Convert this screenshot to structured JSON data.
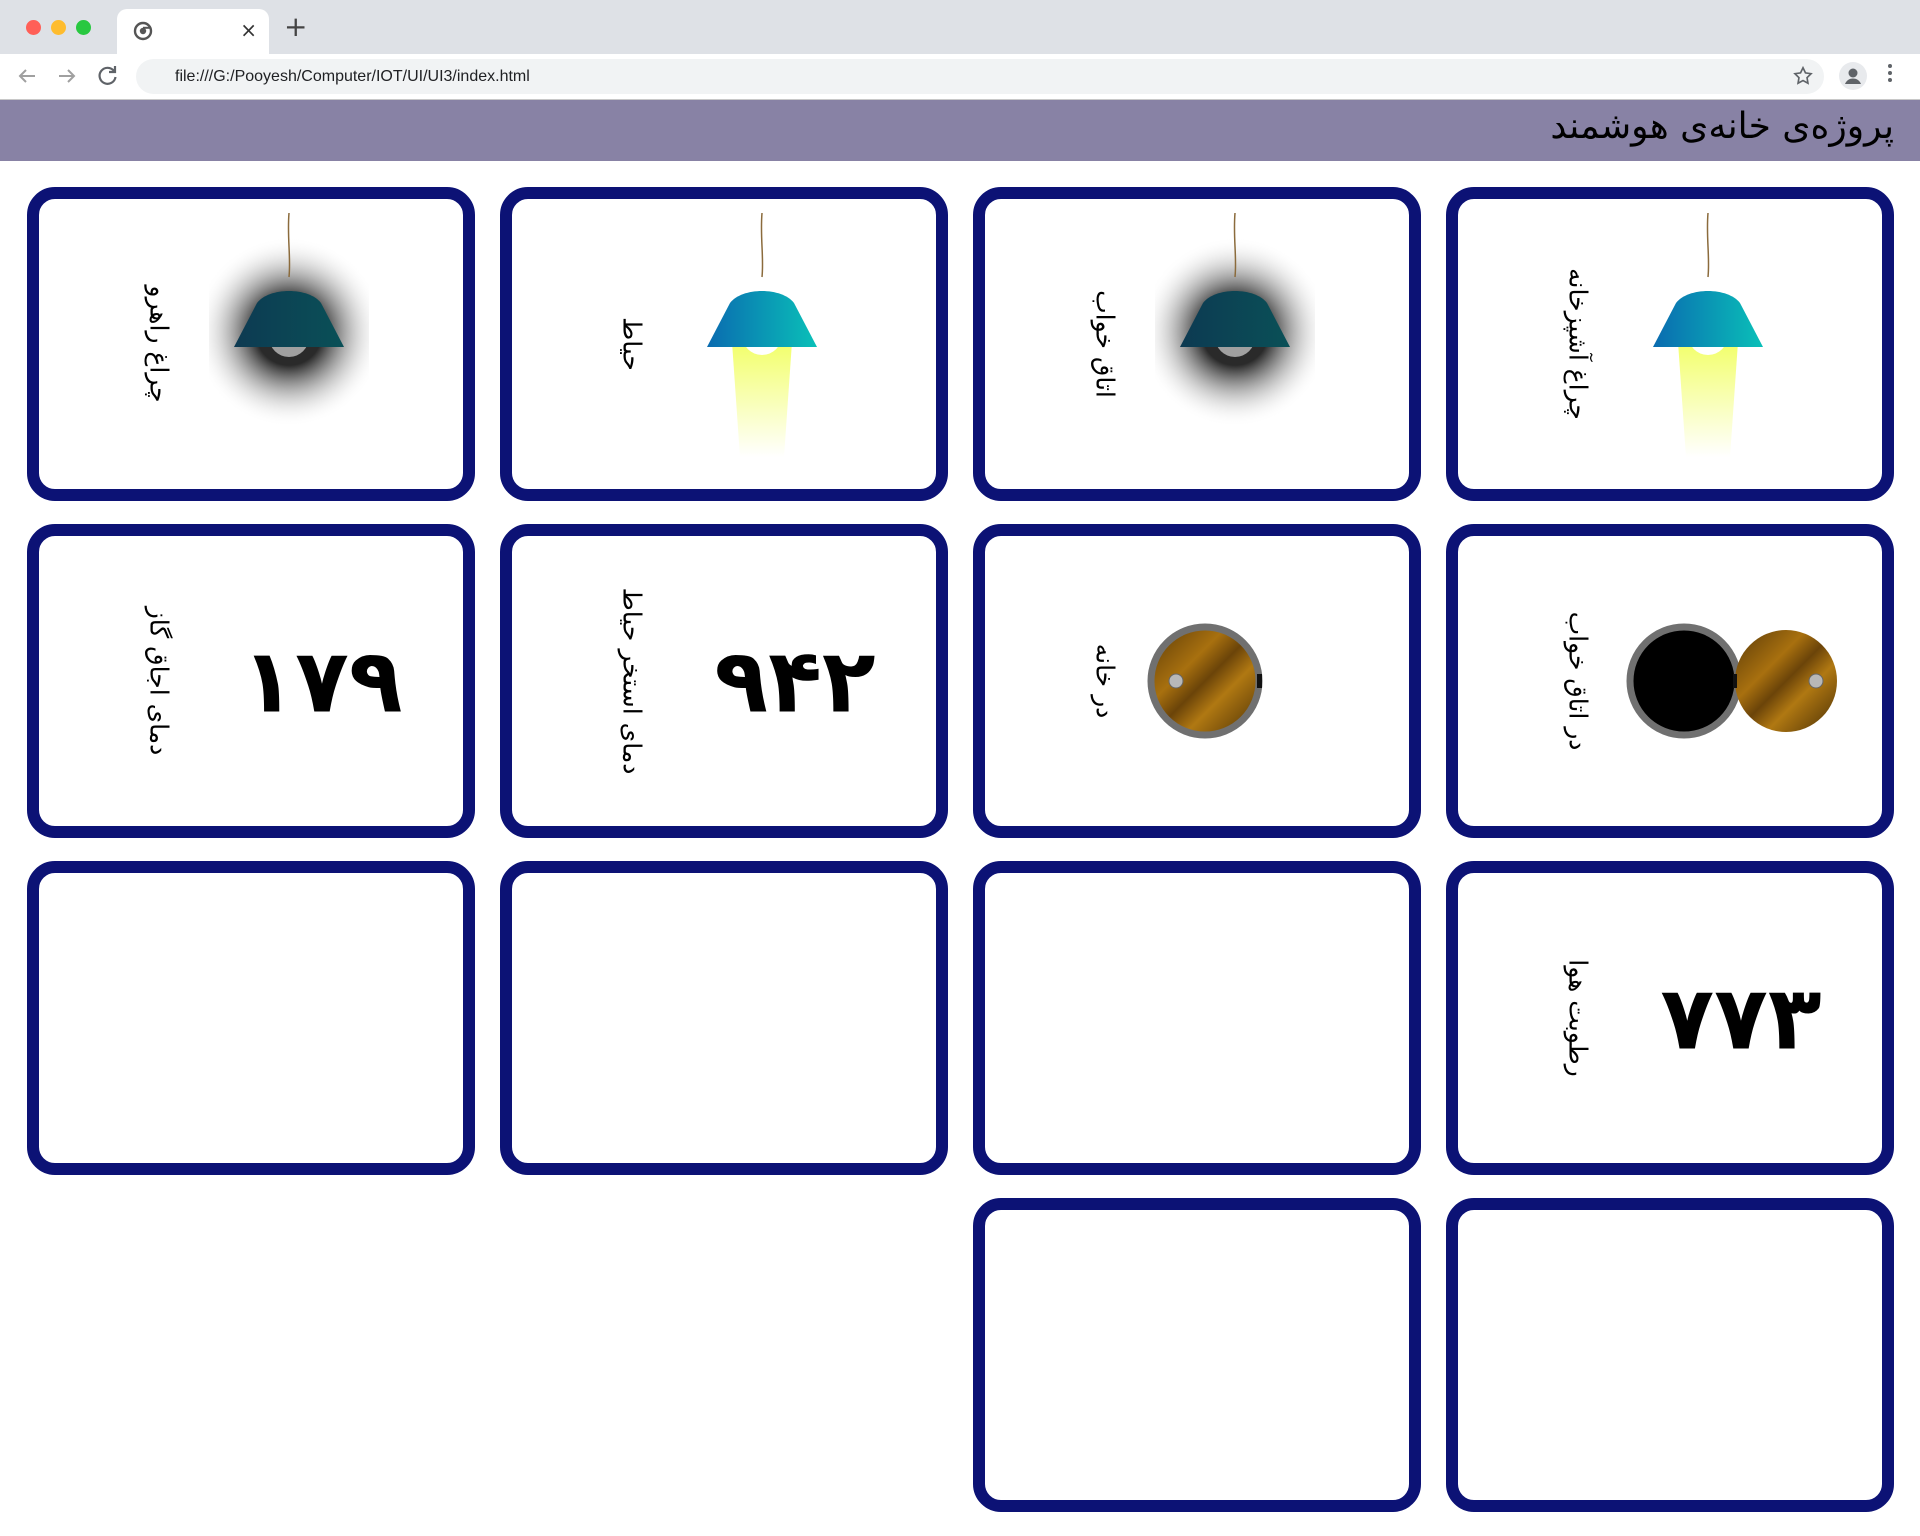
{
  "browser": {
    "url": "file:///G:/Pooyesh/Computer/IOT/UI/UI3/index.html",
    "tab_close": "×",
    "new_tab": "+"
  },
  "header": {
    "title": "پروژه‌ی خانه‌ی هوشمند"
  },
  "colors": {
    "header_bg": "#8882a5",
    "card_border": "#0c1275",
    "lamp_shade": "#0aa3b3",
    "light_glow": "#f2ff6a",
    "door_wood": "#8a5a10"
  },
  "cards": {
    "kitchen_light": {
      "label": "چراغ آشپزخانه",
      "state": "on"
    },
    "bedroom_light": {
      "label": "اتاق خواب",
      "state": "off"
    },
    "yard_light": {
      "label": "حیاط",
      "state": "on"
    },
    "hallway_light": {
      "label": "چراغ راهرو",
      "state": "off"
    },
    "bedroom_door": {
      "label": "در اتاق خواب",
      "state": "open"
    },
    "house_door": {
      "label": "در خانه",
      "state": "closed"
    },
    "pool_temp": {
      "label": "دمای استخر حیاط",
      "value": "۹۴۲"
    },
    "stove_temp": {
      "label": "دمای اجاق گاز",
      "value": "۱۷۹"
    },
    "humidity": {
      "label": "رطوبت هوا",
      "value": "۷۷۳"
    }
  }
}
